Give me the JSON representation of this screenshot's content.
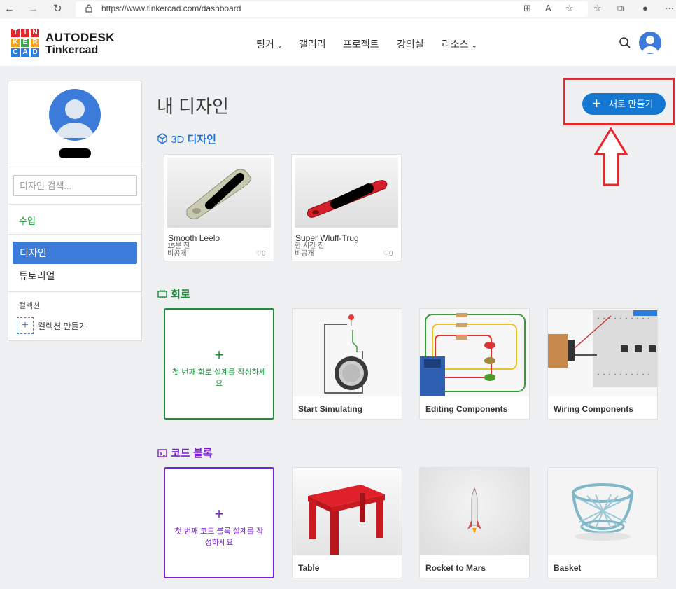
{
  "browser": {
    "url": "https://www.tinkercad.com/dashboard",
    "back_icon": "arrow-left-icon",
    "forward_icon": "arrow-right-icon",
    "reload_icon": "reload-icon",
    "menu_label": "···"
  },
  "header": {
    "logo_letters": [
      "T",
      "I",
      "N",
      "K",
      "E",
      "R",
      "C",
      "A",
      "D"
    ],
    "brand_top": "AUTODESK",
    "brand_bottom": "Tinkercad",
    "nav": [
      "팅커",
      "갤러리",
      "프로젝트",
      "강의실",
      "리소스"
    ]
  },
  "sidebar": {
    "search_placeholder": "디자인 검색...",
    "classes": "수업",
    "designs": "디자인",
    "tutorials": "튜토리얼",
    "collections_label": "컬렉션",
    "create_collection": "컬렉션 만들기"
  },
  "main": {
    "title": "내 디자인",
    "new_button": "새로 만들기",
    "section_3d": {
      "prefix": "3D",
      "title": "디자인"
    },
    "designs": [
      {
        "name": "Smooth Leelo",
        "time": "15분 전",
        "visibility": "비공개",
        "likes": "0"
      },
      {
        "name": "Super Wluff-Trug",
        "time": "한 시간 전",
        "visibility": "비공개",
        "likes": "0"
      }
    ],
    "section_circuits": {
      "title": "회로"
    },
    "circuits_new": "첫 번째 회로 설계를 작성하세요",
    "circuits": [
      "Start Simulating",
      "Editing Components",
      "Wiring Components"
    ],
    "section_code": {
      "title": "코드 블록"
    },
    "code_new": "첫 번째 코드 블록 설계를 작성하세요",
    "code": [
      "Table",
      "Rocket to Mars",
      "Basket"
    ]
  },
  "colors": {
    "primary_blue": "#1477d1",
    "circuits_green": "#1a8f3b",
    "code_purple": "#7b1fd6",
    "highlight_red": "#e8262c"
  }
}
